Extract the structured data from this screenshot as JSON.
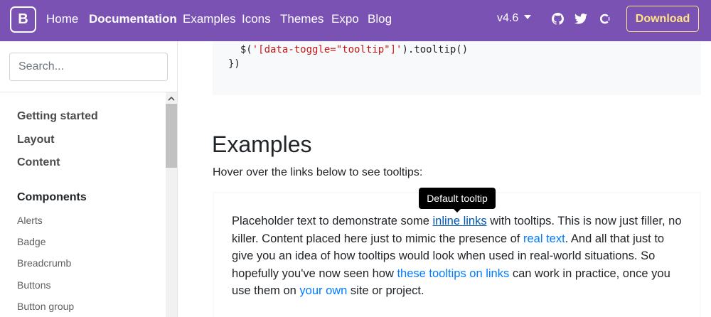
{
  "navbar": {
    "brand": "B",
    "links": [
      "Home",
      "Documentation",
      "Examples",
      "Icons",
      "Themes",
      "Expo",
      "Blog"
    ],
    "version": "v4.6",
    "download_label": "Download",
    "icons": [
      "github-icon",
      "twitter-icon",
      "opencollective-icon"
    ],
    "colors": {
      "background": "#7952b3",
      "download": "#ffe484"
    }
  },
  "sidebar": {
    "search_placeholder": "Search...",
    "items": [
      {
        "label": "Getting started"
      },
      {
        "label": "Layout"
      },
      {
        "label": "Content"
      },
      {
        "label": "Components"
      },
      {
        "label": "Alerts"
      },
      {
        "label": "Badge"
      },
      {
        "label": "Breadcrumb"
      },
      {
        "label": "Buttons"
      },
      {
        "label": "Button group"
      }
    ]
  },
  "code": {
    "line1_prefix": "  $(",
    "line1_string": "'[data-toggle=\"tooltip\"]'",
    "line1_suffix": ").tooltip()",
    "line2": "})"
  },
  "main": {
    "heading": "Examples",
    "lead": "Hover over the links below to see tooltips:",
    "tooltip": "Default tooltip",
    "paragraph": {
      "t1": "Placeholder text to demonstrate some ",
      "link1": "inline links",
      "t2": " with tooltips. This is now just filler, no killer. Content placed here just to mimic the presence of ",
      "link2": "real text",
      "t3": ". And all that just to give you an idea of how tooltips would look when used in real-world situations. So hopefully you've now seen how ",
      "link3": "these tooltips on links",
      "t4": " can work in practice, once you use them on ",
      "link4": "your own",
      "t5": " site or project."
    }
  }
}
